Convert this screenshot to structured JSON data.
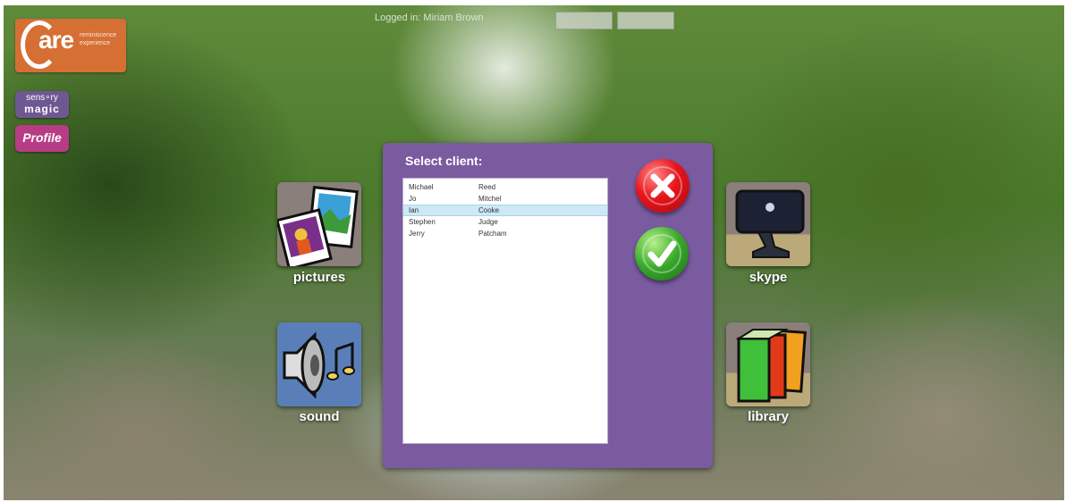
{
  "header": {
    "logged_in_text": "Logged in: Miriam Brown"
  },
  "logo": {
    "big": "are",
    "small_line1": "reminiscence",
    "small_line2": "experience"
  },
  "badges": {
    "sensory_line1": "sens∘ry",
    "sensory_line2": "magic",
    "profile": "Profile"
  },
  "tiles": {
    "pictures": "pictures",
    "sound": "sound",
    "skype": "skype",
    "library": "library"
  },
  "modal": {
    "title": "Select client:",
    "clients": [
      {
        "first": "Michael",
        "last": "Reed"
      },
      {
        "first": "Jo",
        "last": "Mitchel"
      },
      {
        "first": "Ian",
        "last": "Cooke"
      },
      {
        "first": "Stephen",
        "last": "Judge"
      },
      {
        "first": "Jerry",
        "last": "Patcham"
      }
    ],
    "selected_index": 2
  },
  "colors": {
    "modal_bg": "#7a5ba0",
    "selection": "#cde8f6",
    "cancel": "#e8141b",
    "confirm": "#37a82a",
    "logo": "#d56f34"
  },
  "icons": {
    "cancel": "close-x-icon",
    "confirm": "checkmark-icon",
    "pictures": "photos-icon",
    "sound": "speaker-music-icon",
    "skype": "webcam-icon",
    "library": "books-icon"
  }
}
